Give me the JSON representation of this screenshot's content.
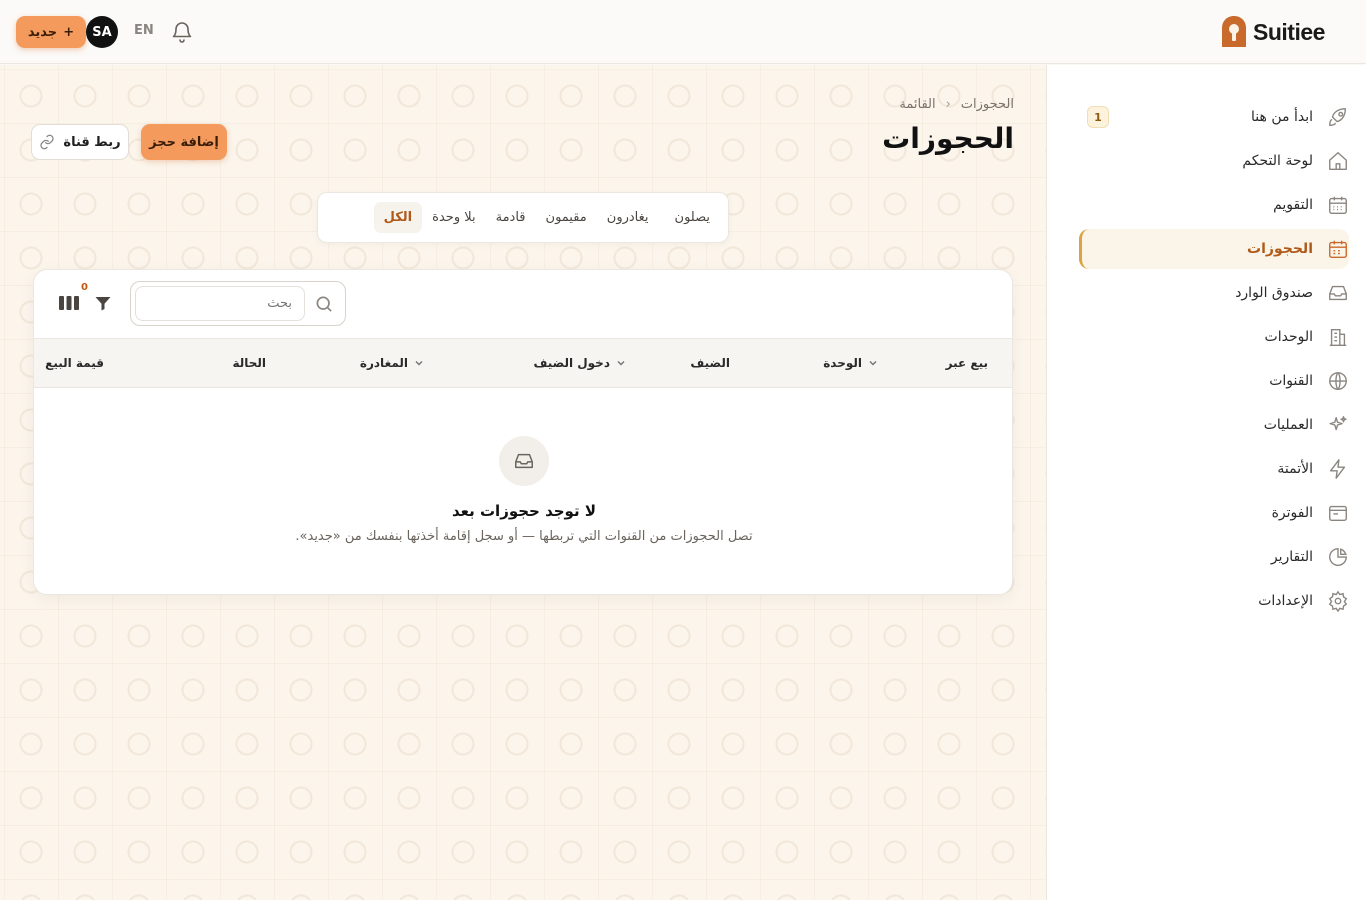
{
  "header": {
    "new_button_label": "جديد",
    "avatar_initials": "SA",
    "language": "EN",
    "brand": "Suitiee"
  },
  "sidebar": {
    "items": [
      {
        "label": "ابدأ من هنا",
        "icon": "rocket-icon",
        "badge": "1"
      },
      {
        "label": "لوحة التحكم",
        "icon": "home-icon"
      },
      {
        "label": "التقويم",
        "icon": "calendar-icon"
      },
      {
        "label": "الحجوزات",
        "icon": "calendar-bookings-icon",
        "active": true
      },
      {
        "label": "صندوق الوارد",
        "icon": "inbox-icon"
      },
      {
        "label": "الوحدات",
        "icon": "building-icon"
      },
      {
        "label": "القنوات",
        "icon": "globe-icon"
      },
      {
        "label": "العمليات",
        "icon": "sparkles-icon"
      },
      {
        "label": "الأتمتة",
        "icon": "lightning-icon"
      },
      {
        "label": "الفوترة",
        "icon": "wallet-icon"
      },
      {
        "label": "التقارير",
        "icon": "pie-chart-icon"
      },
      {
        "label": "الإعدادات",
        "icon": "gear-icon"
      }
    ]
  },
  "breadcrumb": {
    "root": "الحجوزات",
    "current": "القائمة"
  },
  "page": {
    "title": "الحجوزات",
    "add_booking": "إضافة حجز",
    "link_channel": "ربط قناة"
  },
  "tabs": [
    "يصلون",
    "يغادرون",
    "مقيمون",
    "قادمة",
    "بلا وحدة",
    "الكل"
  ],
  "active_tab": "الكل",
  "toolbar": {
    "search_placeholder": "بحث",
    "filter_count": "0"
  },
  "table": {
    "columns": [
      "بيع عبر",
      "الوحدة",
      "الضيف",
      "دخول الضيف",
      "المغادرة",
      "الحالة",
      "قيمة البيع"
    ]
  },
  "empty_state": {
    "title": "لا توجد حجوزات بعد",
    "description": "تصل الحجوزات من القنوات التي تربطها — أو سجل إقامة أخذتها بنفسك من «جديد»."
  },
  "colors": {
    "accent": "#f39a5c",
    "active_text": "#b05a1a",
    "active_border": "#d9a441"
  }
}
